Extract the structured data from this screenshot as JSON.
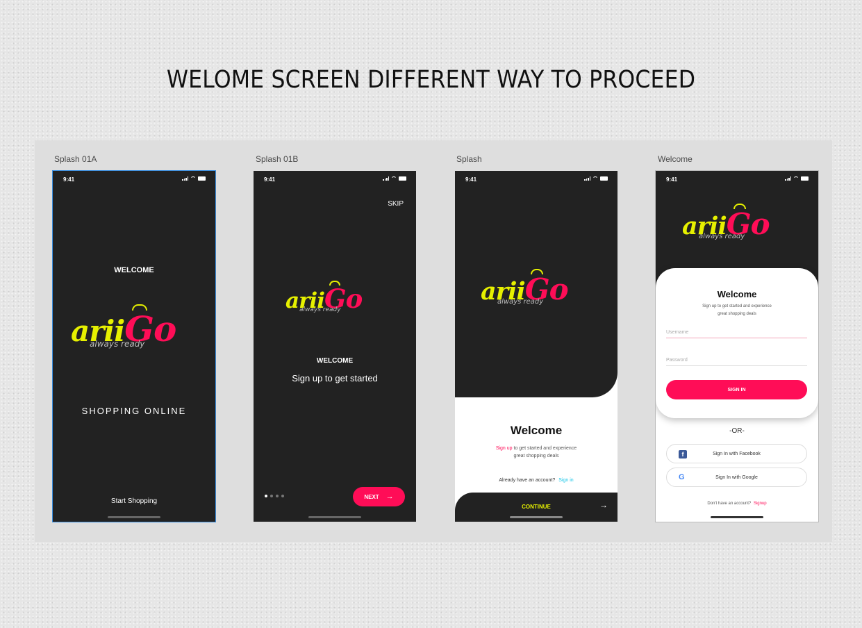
{
  "page_title": "WELOME SCREEN DIFFERENT WAY TO PROCEED",
  "colors": {
    "dark": "#222222",
    "accent_pink": "#ff0d57",
    "logo_yellow": "#e6f000",
    "link_cyan": "#17c6e8"
  },
  "status_time": "9:41",
  "logo": {
    "word": "arii",
    "go": "Go",
    "tagline": "always ready"
  },
  "artboards": [
    {
      "label": "Splash 01A",
      "welcome": "WELCOME",
      "shopping": "SHOPPING ONLINE",
      "cta": "Start Shopping"
    },
    {
      "label": "Splash 01B",
      "skip": "SKIP",
      "welcome": "WELCOME",
      "subtitle": "Sign up to get started",
      "next": "NEXT",
      "dots_active": 1,
      "dots_total": 4
    },
    {
      "label": "Splash",
      "heading": "Welcome",
      "desc_link": "Sign up",
      "desc_rest": " to get started and experience",
      "desc_line2": "great shopping deals",
      "account_text": "Already have an account?",
      "signin_link": "Sign in",
      "cta": "CONTINUE"
    },
    {
      "label": "Welcome",
      "heading": "Welcome",
      "desc_line1": "Sign up to get started and experience",
      "desc_line2": "great shopping deals",
      "username_placeholder": "Username",
      "password_placeholder": "Password",
      "signin": "SIGN IN",
      "or": "-OR-",
      "facebook": "Sign In with Facebook",
      "google": "Sign In with Google",
      "no_account": "Don't have an account?",
      "signup_link": "Signup"
    }
  ]
}
